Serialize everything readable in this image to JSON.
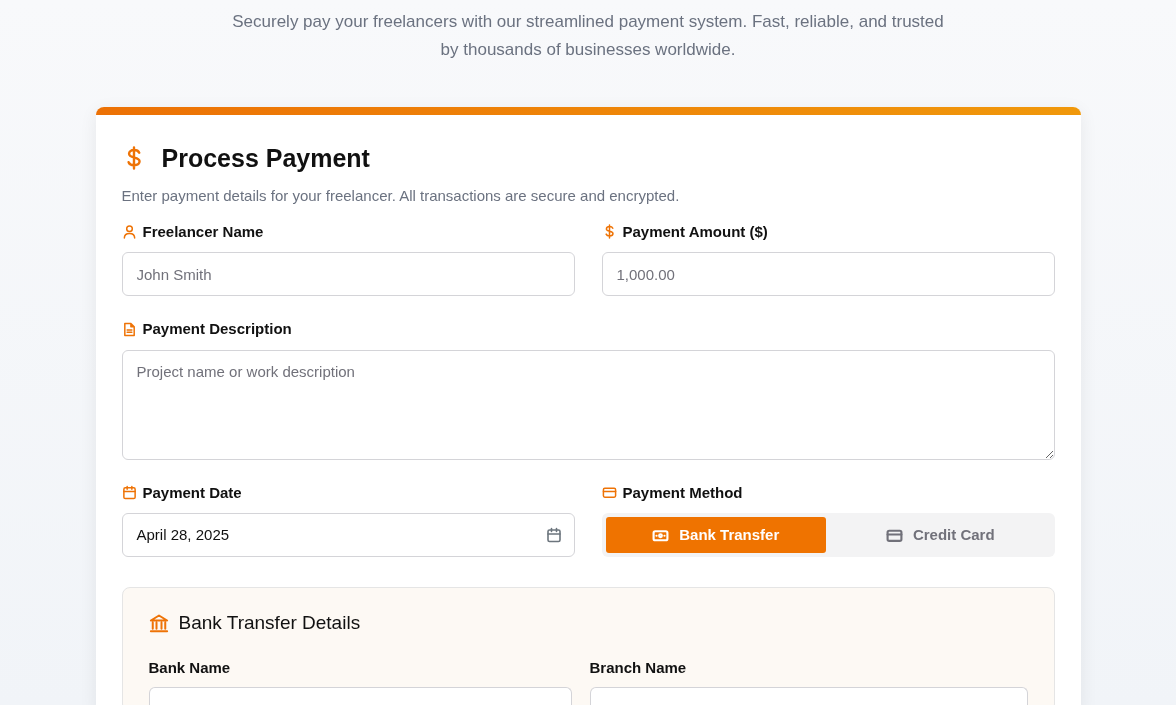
{
  "intro": "Securely pay your freelancers with our streamlined payment system. Fast, reliable, and trusted by thousands of businesses worldwide.",
  "form": {
    "title": "Process Payment",
    "description": "Enter payment details for your freelancer. All transactions are secure and encrypted.",
    "fields": [
      {
        "kind": "text",
        "label": "Freelancer Name",
        "placeholder": "John Smith"
      },
      {
        "kind": "text",
        "label": "Payment Amount ($)",
        "placeholder": "1,000.00"
      },
      {
        "kind": "textarea",
        "label": "Payment Description",
        "placeholder": "Project name or work description"
      },
      {
        "kind": "date",
        "label": "Payment Date",
        "value": "April 28, 2025"
      },
      {
        "kind": "methods",
        "label": "Payment Method",
        "options": [
          {
            "label": "Bank Transfer",
            "selected": true
          },
          {
            "label": "Credit Card",
            "selected": false
          }
        ]
      }
    ],
    "details": {
      "title": "Bank Transfer Details",
      "fields": [
        {
          "label": "Bank Name"
        },
        {
          "label": "Branch Name"
        }
      ]
    }
  }
}
